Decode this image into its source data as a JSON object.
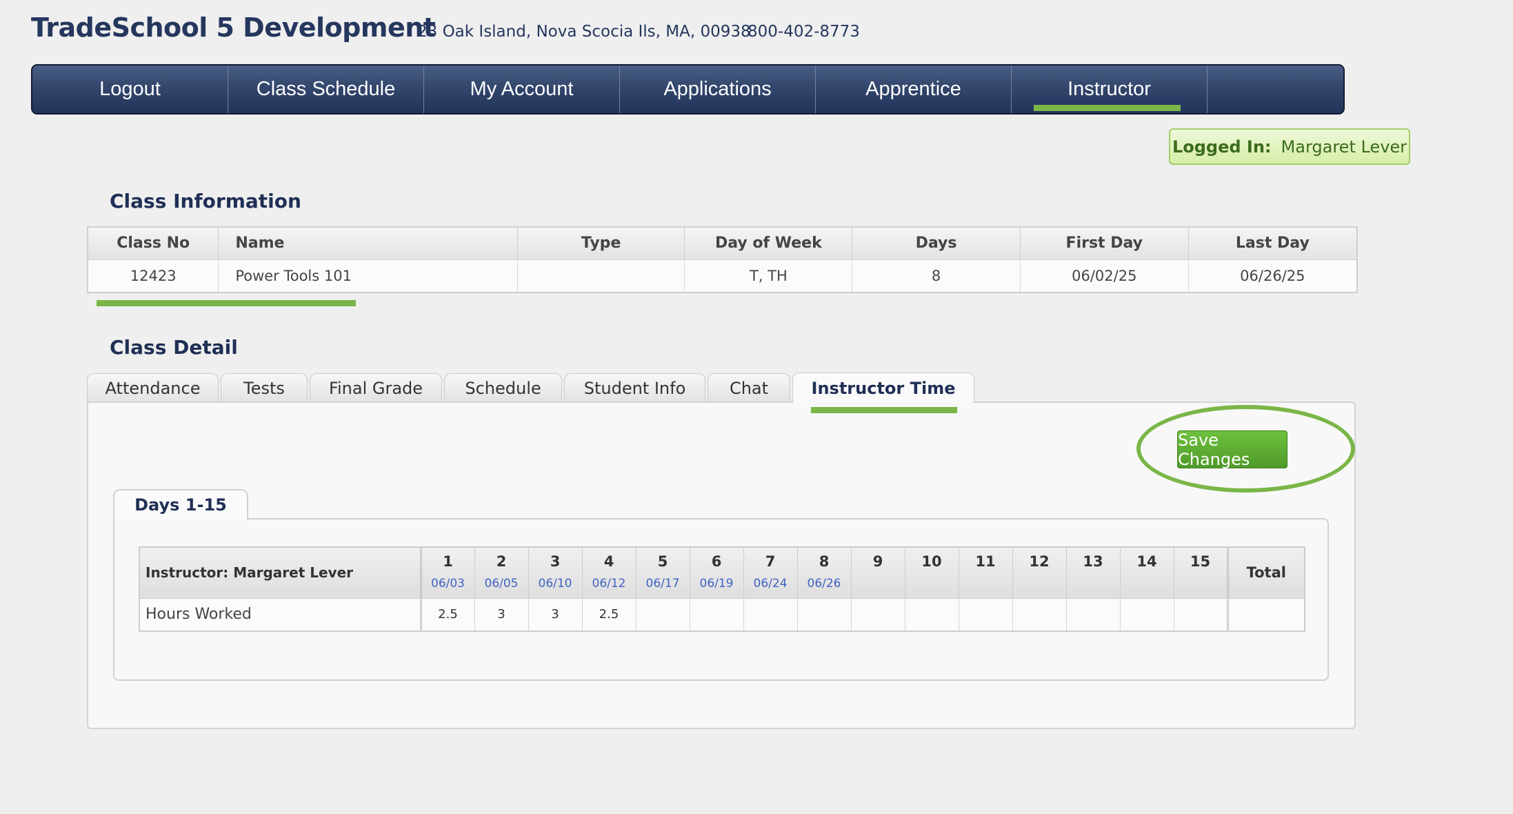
{
  "header": {
    "title": "TradeSchool 5 Development",
    "address": "23 Oak Island, Nova Scocia Ils, MA, 00938",
    "phone": "800-402-8773"
  },
  "nav": {
    "logout": "Logout",
    "class_schedule": "Class Schedule",
    "my_account": "My Account",
    "applications": "Applications",
    "apprentice": "Apprentice",
    "instructor": "Instructor",
    "active": "Instructor"
  },
  "login": {
    "label": "Logged In:",
    "user": "Margaret Lever"
  },
  "class_info": {
    "title": "Class Information",
    "headers": [
      "Class No",
      "Name",
      "Type",
      "Day of Week",
      "Days",
      "First Day",
      "Last Day"
    ],
    "row": {
      "class_no": "12423",
      "name": "Power Tools 101",
      "type": "",
      "day_of_week": "T, TH",
      "days": "8",
      "first_day": "06/02/25",
      "last_day": "06/26/25"
    }
  },
  "class_detail": {
    "title": "Class Detail",
    "tabs": [
      "Attendance",
      "Tests",
      "Final Grade",
      "Schedule",
      "Student Info",
      "Chat",
      "Instructor Time"
    ],
    "active_tab": "Instructor Time",
    "save_label": "Save Changes",
    "days_tab": "Days 1-15",
    "hours": {
      "instructor_header": "Instructor: Margaret Lever",
      "row_label": "Hours Worked",
      "total_header": "Total",
      "days": [
        {
          "num": "1",
          "date": "06/03",
          "hours": "2.5"
        },
        {
          "num": "2",
          "date": "06/05",
          "hours": "3"
        },
        {
          "num": "3",
          "date": "06/10",
          "hours": "3"
        },
        {
          "num": "4",
          "date": "06/12",
          "hours": "2.5"
        },
        {
          "num": "5",
          "date": "06/17",
          "hours": ""
        },
        {
          "num": "6",
          "date": "06/19",
          "hours": ""
        },
        {
          "num": "7",
          "date": "06/24",
          "hours": ""
        },
        {
          "num": "8",
          "date": "06/26",
          "hours": ""
        },
        {
          "num": "9",
          "date": "",
          "hours": ""
        },
        {
          "num": "10",
          "date": "",
          "hours": ""
        },
        {
          "num": "11",
          "date": "",
          "hours": ""
        },
        {
          "num": "12",
          "date": "",
          "hours": ""
        },
        {
          "num": "13",
          "date": "",
          "hours": ""
        },
        {
          "num": "14",
          "date": "",
          "hours": ""
        },
        {
          "num": "15",
          "date": "",
          "hours": ""
        }
      ],
      "total": ""
    }
  },
  "colors": {
    "accent_green": "#7ab648",
    "nav_navy": "#33466c",
    "title_navy": "#25375e",
    "date_blue": "#3f63c4"
  }
}
